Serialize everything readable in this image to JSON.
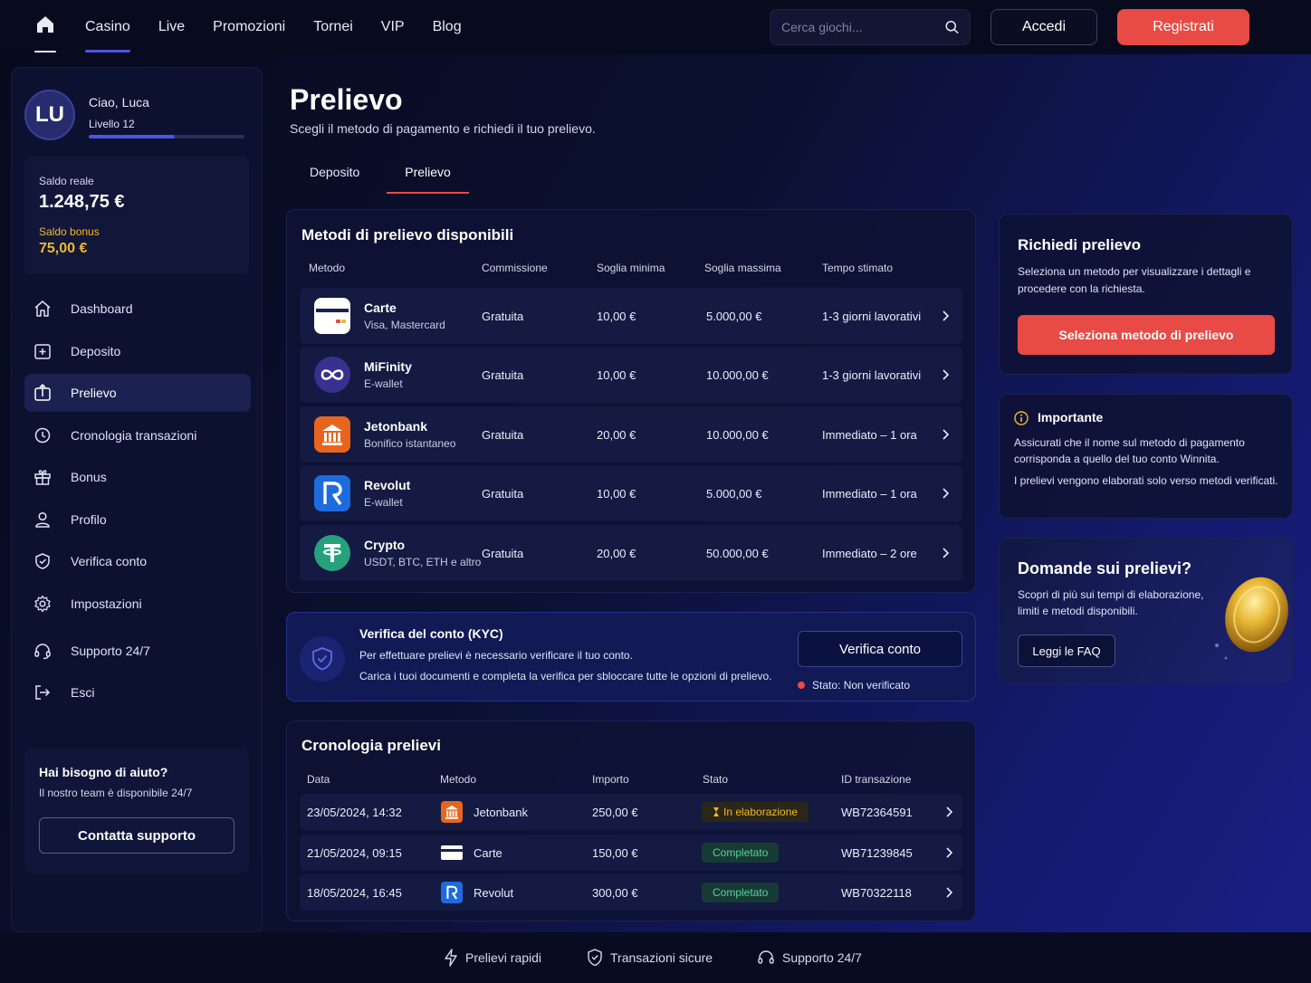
{
  "nav": {
    "links": [
      "Casino",
      "Live",
      "Promozioni",
      "Tornei",
      "VIP",
      "Blog"
    ],
    "active": "Casino",
    "search_placeholder": "Cerca giochi...",
    "login_label": "Accedi",
    "register_label": "Registrati"
  },
  "user": {
    "initials": "LU",
    "greeting": "Ciao, Luca",
    "level": "Livello 12",
    "level_progress": 0.55
  },
  "balance": {
    "real_label": "Saldo reale",
    "real_value": "1.248,75 €",
    "bonus_label": "Saldo bonus",
    "bonus_value": "75,00 €"
  },
  "sidebar": {
    "items": [
      {
        "label": "Dashboard",
        "icon": "home-icon"
      },
      {
        "label": "Deposito",
        "icon": "deposit-icon"
      },
      {
        "label": "Prelievo",
        "icon": "withdraw-icon"
      },
      {
        "label": "Cronologia transazioni",
        "icon": "history-icon"
      },
      {
        "label": "Bonus",
        "icon": "gift-icon"
      },
      {
        "label": "Profilo",
        "icon": "user-icon"
      },
      {
        "label": "Verifica conto",
        "icon": "shield-icon"
      },
      {
        "label": "Impostazioni",
        "icon": "gear-icon"
      },
      {
        "label": "Supporto 24/7",
        "icon": "headset-icon"
      },
      {
        "label": "Esci",
        "icon": "logout-icon"
      }
    ],
    "active_index": 2
  },
  "help": {
    "title": "Hai bisogno di aiuto?",
    "subtitle": "Il nostro team è disponibile 24/7",
    "button": "Contatta supporto"
  },
  "page": {
    "title": "Prelievo",
    "subtitle": "Scegli il metodo di pagamento e richiedi il tuo prelievo.",
    "tabs": [
      "Deposito",
      "Prelievo"
    ],
    "active_tab": 1
  },
  "methods": {
    "title": "Metodi di prelievo disponibili",
    "columns": [
      "Metodo",
      "Commissione",
      "Soglia minima",
      "Soglia massima",
      "Tempo stimato"
    ],
    "rows": [
      {
        "name": "Carte",
        "desc": "Visa, Mastercard",
        "fee": "Gratuita",
        "min": "10,00 €",
        "max": "5.000,00 €",
        "time": "1-3 giorni lavorativi",
        "logo": "card-icon",
        "color": "#ffffff"
      },
      {
        "name": "MiFinity",
        "desc": "E-wallet",
        "fee": "Gratuita",
        "min": "10,00 €",
        "max": "10.000,00 €",
        "time": "1-3 giorni lavorativi",
        "logo": "infinity-icon",
        "color": "#3a3090"
      },
      {
        "name": "Jetonbank",
        "desc": "Bonifico istantaneo",
        "fee": "Gratuita",
        "min": "20,00 €",
        "max": "10.000,00 €",
        "time": "Immediato – 1 ora",
        "logo": "bank-icon",
        "color": "#e8651e"
      },
      {
        "name": "Revolut",
        "desc": "E-wallet",
        "fee": "Gratuita",
        "min": "10,00 €",
        "max": "5.000,00 €",
        "time": "Immediato – 1 ora",
        "logo": "revolut-icon",
        "color": "#1d6bde"
      },
      {
        "name": "Crypto",
        "desc": "USDT, BTC, ETH e altro",
        "fee": "Gratuita",
        "min": "20,00 €",
        "max": "50.000,00 €",
        "time": "Immediato – 2 ore",
        "logo": "tether-icon",
        "color": "#26a17b"
      }
    ]
  },
  "kyc": {
    "title": "Verifica del conto (KYC)",
    "line1": "Per effettuare prelievi è necessario verificare il tuo conto.",
    "line2": "Carica i tuoi documenti e completa la verifica per sbloccare tutte le opzioni di prelievo.",
    "button": "Verifica conto",
    "status": "Stato: Non verificato"
  },
  "history": {
    "title": "Cronologia prelievi",
    "columns": [
      "Data",
      "Metodo",
      "Importo",
      "Stato",
      "ID transazione"
    ],
    "rows": [
      {
        "date": "23/05/2024, 14:32",
        "method": "Jetonbank",
        "amount": "250,00 €",
        "status": "In elaborazione",
        "status_type": "pending",
        "id": "WB72364591",
        "logo": "bank-icon",
        "color": "#e8651e"
      },
      {
        "date": "21/05/2024, 09:15",
        "method": "Carte",
        "amount": "150,00 €",
        "status": "Completato",
        "status_type": "done",
        "id": "WB71239845",
        "logo": "card-icon",
        "color": "#ffffff"
      },
      {
        "date": "18/05/2024, 16:45",
        "method": "Revolut",
        "amount": "300,00 €",
        "status": "Completato",
        "status_type": "done",
        "id": "WB70322118",
        "logo": "revolut-icon",
        "color": "#1d6bde"
      }
    ]
  },
  "request": {
    "title": "Richiedi prelievo",
    "subtitle": "Seleziona un metodo per visualizzare i dettagli e procedere con la richiesta.",
    "button": "Seleziona metodo di prelievo"
  },
  "important": {
    "title": "Importante",
    "line1": "Assicurati che il nome sul metodo di pagamento corrisponda a quello del tuo conto Winnita.",
    "line2": "I prelievi vengono elaborati solo verso metodi verificati."
  },
  "faq": {
    "title": "Domande sui prelievi?",
    "subtitle": "Scopri di più sui tempi di elaborazione, limiti e metodi disponibili.",
    "button": "Leggi le FAQ"
  },
  "footer": {
    "items": [
      "Prelievi rapidi",
      "Transazioni sicure",
      "Supporto 24/7"
    ]
  },
  "colors": {
    "accent": "#e84a45",
    "primary": "#4b54e6",
    "bonus": "#f1b92b",
    "success": "#52d39b"
  }
}
